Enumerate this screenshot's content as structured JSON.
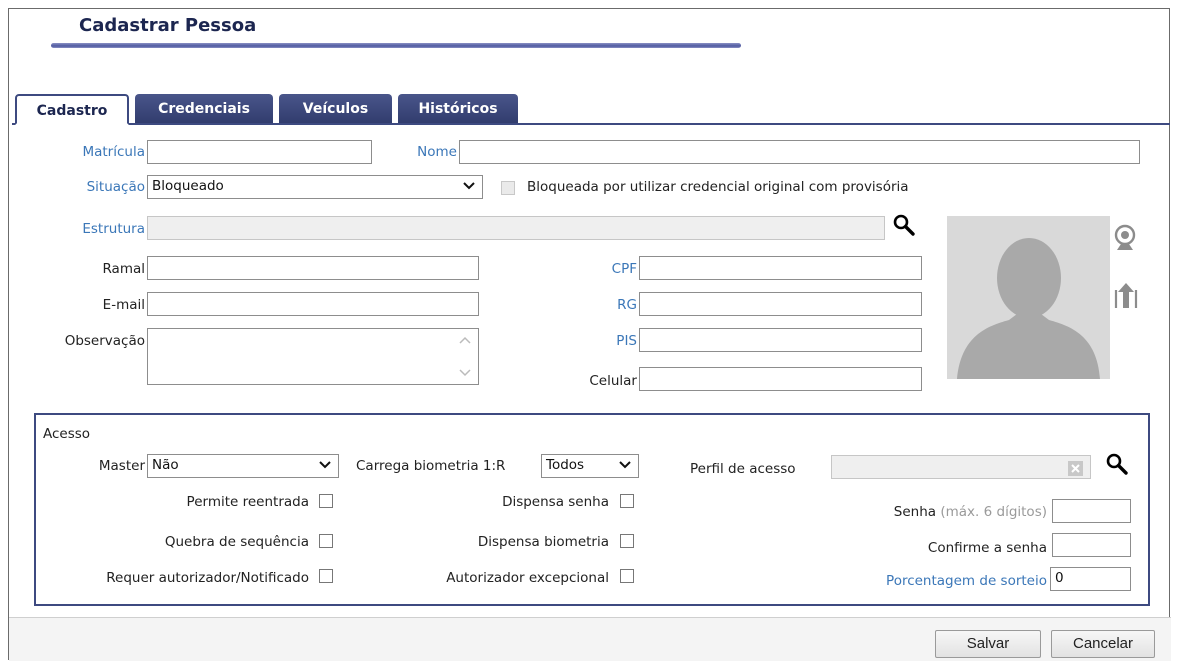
{
  "page_title": "Cadastrar Pessoa",
  "tabs": [
    {
      "label": "Cadastro",
      "active": true
    },
    {
      "label": "Credenciais",
      "active": false
    },
    {
      "label": "Veículos",
      "active": false
    },
    {
      "label": "Históricos",
      "active": false
    }
  ],
  "form": {
    "matricula": {
      "label": "Matrícula",
      "value": ""
    },
    "nome": {
      "label": "Nome",
      "value": ""
    },
    "situacao": {
      "label": "Situação",
      "value": "Bloqueado"
    },
    "bloqueada": {
      "label": "Bloqueada por utilizar credencial original com provisória",
      "checked": false
    },
    "estrutura": {
      "label": "Estrutura",
      "value": ""
    },
    "ramal": {
      "label": "Ramal",
      "value": ""
    },
    "email": {
      "label": "E-mail",
      "value": ""
    },
    "observacao": {
      "label": "Observação",
      "value": ""
    },
    "cpf": {
      "label": "CPF",
      "value": ""
    },
    "rg": {
      "label": "RG",
      "value": ""
    },
    "pis": {
      "label": "PIS",
      "value": ""
    },
    "celular": {
      "label": "Celular",
      "value": ""
    }
  },
  "acesso": {
    "title": "Acesso",
    "master": {
      "label": "Master",
      "value": "Não"
    },
    "carrega_biometria": {
      "label": "Carrega biometria 1:R",
      "value": "Todos"
    },
    "perfil_acesso": {
      "label": "Perfil de acesso",
      "value": ""
    },
    "permite_reentrada": {
      "label": "Permite reentrada",
      "checked": false
    },
    "quebra_sequencia": {
      "label": "Quebra de sequência",
      "checked": false
    },
    "requer_autorizador": {
      "label": "Requer autorizador/Notificado",
      "checked": false
    },
    "dispensa_senha": {
      "label": "Dispensa senha",
      "checked": false
    },
    "dispensa_biometria": {
      "label": "Dispensa biometria",
      "checked": false
    },
    "autorizador_excepcional": {
      "label": "Autorizador excepcional",
      "checked": false
    },
    "senha": {
      "label": "Senha",
      "hint": "(máx. 6 dígitos)",
      "value": ""
    },
    "confirme_senha": {
      "label": "Confirme a senha",
      "value": ""
    },
    "porcentagem_sorteio": {
      "label": "Porcentagem de sorteio",
      "value": "0"
    }
  },
  "buttons": {
    "salvar": "Salvar",
    "cancelar": "Cancelar"
  },
  "colors": {
    "accent": "#3d4a80",
    "link": "#3b77b8",
    "tab_bg": "#303b6c"
  },
  "icons": [
    "search-icon",
    "webcam-icon",
    "upload-photo-icon",
    "clear-icon",
    "chevron-down-icon",
    "avatar-placeholder"
  ]
}
